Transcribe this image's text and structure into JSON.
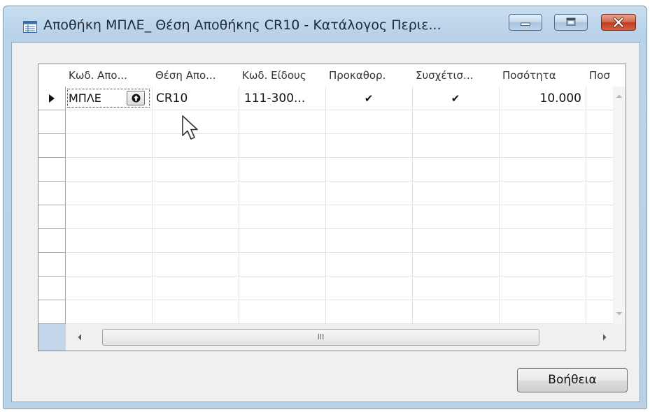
{
  "window": {
    "title": "Αποθήκη ΜΠΛΕ_ Θέση Αποθήκης CR10 - Κατάλογος Περιε..."
  },
  "title_controls": {
    "minimize_icon": "minimize-icon",
    "maximize_icon": "maximize-icon",
    "close_icon": "close-icon"
  },
  "grid": {
    "columns": [
      "Κωδ. Απο...",
      "Θέση Απο...",
      "Κωδ. Είδους",
      "Προκαθορ.",
      "Συσχέτισ...",
      "Ποσότητα",
      "Ποσ"
    ],
    "rows": [
      {
        "location_code": "ΜΠΛΕ",
        "bin_code": "CR10",
        "item_no": "111-300...",
        "default": "✔",
        "associated": "✔",
        "quantity": "10.000"
      }
    ],
    "current_row_indicator": "▶"
  },
  "hscroll": {
    "thumb_glyph": "III"
  },
  "buttons": {
    "help_label": "Βοήθεια"
  }
}
